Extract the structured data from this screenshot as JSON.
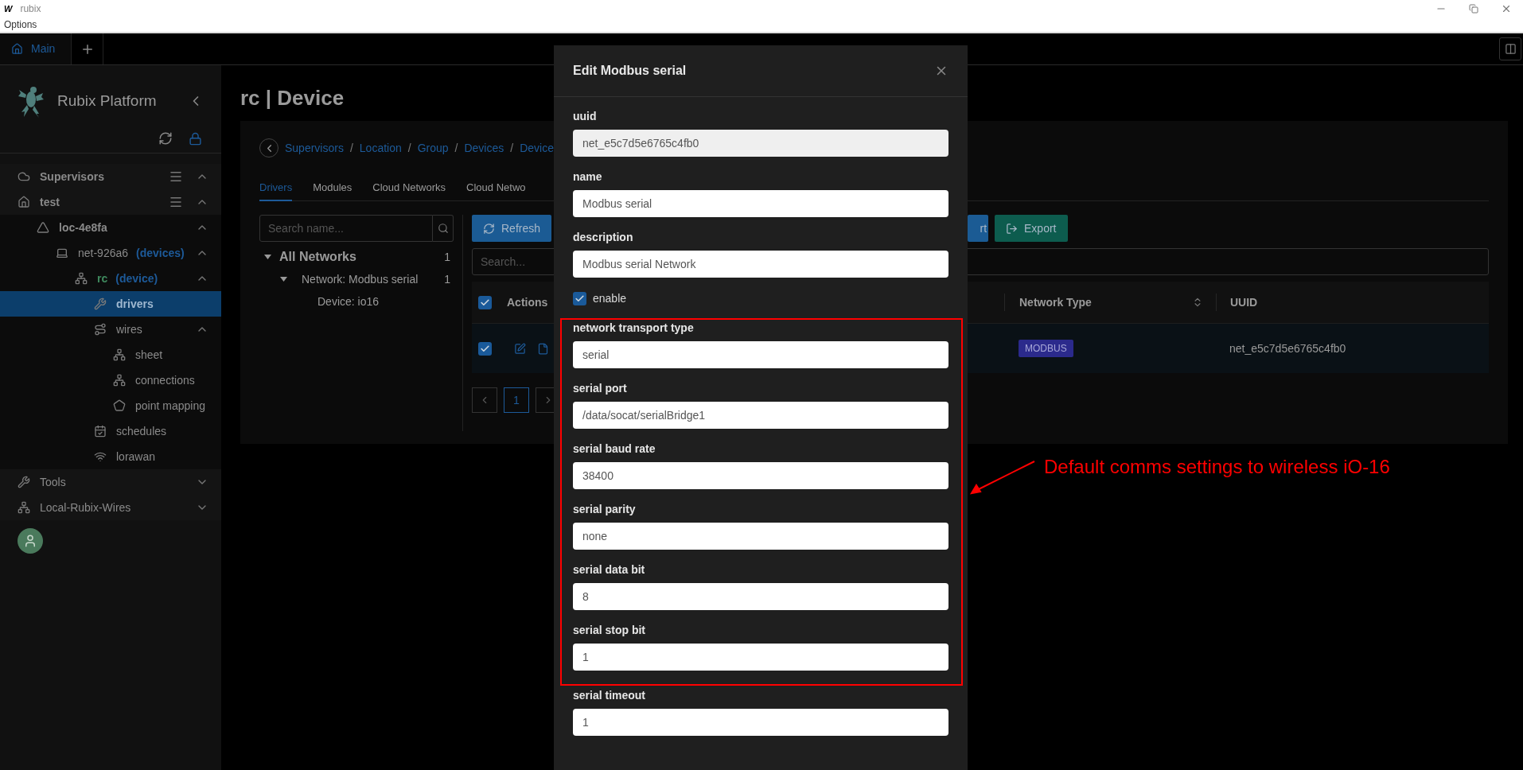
{
  "window": {
    "logo": "W",
    "title": "rubix",
    "menu": [
      "Options"
    ]
  },
  "tabs": [
    {
      "label": "Main",
      "selected": true
    }
  ],
  "sidebar": {
    "title": "Rubix Platform",
    "items": [
      {
        "label": "Supervisors",
        "kind": "cloud",
        "bold": true,
        "menu": true,
        "expanded": true,
        "selected": false
      },
      {
        "label": "test",
        "kind": "home",
        "bold": true,
        "menu": true,
        "expanded": true,
        "selected": false,
        "children": [
          {
            "label": "loc-4e8fa",
            "kind": "location",
            "bold": true,
            "menu": false,
            "expanded": true,
            "selected": false,
            "children": [
              {
                "label": "net-926a6",
                "tag": "(devices)",
                "kind": "laptop",
                "bold": false,
                "menu": false,
                "expanded": true,
                "selected": false,
                "children": [
                  {
                    "label": "rc",
                    "tag": "(device)",
                    "color": "#3f8a5e",
                    "kind": "hierarchy",
                    "bold": true,
                    "menu": false,
                    "expanded": true,
                    "selected": false,
                    "children": [
                      {
                        "label": "drivers",
                        "kind": "wrench",
                        "bold": true,
                        "menu": false,
                        "selected": true
                      },
                      {
                        "label": "wires",
                        "kind": "wires",
                        "bold": false,
                        "menu": false,
                        "expanded": true,
                        "selected": false,
                        "children": [
                          {
                            "label": "sheet",
                            "kind": "hierarchy",
                            "bold": false,
                            "menu": false,
                            "selected": false
                          },
                          {
                            "label": "connections",
                            "kind": "hierarchy",
                            "bold": false,
                            "menu": false,
                            "selected": false
                          },
                          {
                            "label": "point mapping",
                            "kind": "pentagon",
                            "bold": false,
                            "menu": false,
                            "selected": false
                          }
                        ]
                      },
                      {
                        "label": "schedules",
                        "kind": "calendar",
                        "bold": false,
                        "menu": false,
                        "selected": false
                      },
                      {
                        "label": "lorawan",
                        "kind": "wifi",
                        "bold": false,
                        "menu": false,
                        "selected": false
                      }
                    ]
                  }
                ]
              }
            ]
          }
        ]
      },
      {
        "label": "Tools",
        "kind": "wrench",
        "bold": false,
        "menu": false,
        "expanded": false,
        "selected": false
      },
      {
        "label": "Local-Rubix-Wires",
        "kind": "hierarchy",
        "bold": false,
        "menu": false,
        "expanded": false,
        "selected": false
      }
    ]
  },
  "page": {
    "title": "rc | Device",
    "breadcrumb": [
      "Supervisors",
      "Location",
      "Group",
      "Devices",
      "Device"
    ],
    "breadcrumb_separator": "/",
    "tabs": [
      {
        "label": "Drivers",
        "selected": true
      },
      {
        "label": "Modules",
        "selected": false
      },
      {
        "label": "Cloud Networks",
        "selected": false
      },
      {
        "label": "Cloud Netwo",
        "selected": false
      }
    ],
    "network_tree": {
      "placeholder": "Search name...",
      "items": [
        {
          "label": "All Networks",
          "count": "1",
          "expanded": true,
          "children": [
            {
              "label": "Network: Modbus serial",
              "count": "1",
              "expanded": true,
              "children": [
                {
                  "label": "Device: io16"
                }
              ]
            }
          ]
        }
      ]
    },
    "toolbar": [
      {
        "label": "Refresh",
        "kind": "refresh"
      },
      {
        "label": "rt",
        "kind": "import"
      },
      {
        "label": "Export",
        "kind": "export"
      }
    ],
    "table": {
      "placeholder": "Search...",
      "all_checked": true,
      "columns": [
        "Actions",
        "Network Type",
        "UUID"
      ],
      "rows": [
        {
          "checked": true,
          "network_type": "MODBUS",
          "uuid": "net_e5c7d5e6765c4fb0"
        }
      ]
    },
    "pagination": [
      {
        "label": "1",
        "selected": true
      }
    ]
  },
  "dialog": {
    "title": "Edit Modbus serial",
    "fields": [
      {
        "kind": "text",
        "label": "uuid",
        "value": "net_e5c7d5e6765c4fb0",
        "disabled": true
      },
      {
        "kind": "text",
        "label": "name",
        "value": "Modbus serial"
      },
      {
        "kind": "text",
        "label": "description",
        "value": "Modbus serial Network"
      },
      {
        "kind": "checkbox",
        "label": "enable",
        "checked": true
      }
    ],
    "highlighted_fields": [
      {
        "kind": "text",
        "label": "network transport type",
        "value": "serial"
      },
      {
        "kind": "text",
        "label": "serial port",
        "value": "/data/socat/serialBridge1"
      },
      {
        "kind": "text",
        "label": "serial baud rate",
        "value": "38400"
      },
      {
        "kind": "text",
        "label": "serial parity",
        "value": "none"
      },
      {
        "kind": "text",
        "label": "serial data bit",
        "value": "8"
      },
      {
        "kind": "text",
        "label": "serial stop bit",
        "value": "1"
      }
    ],
    "more_fields": [
      {
        "kind": "text",
        "label": "serial timeout",
        "value": "1"
      }
    ],
    "annotation": "Default comms settings to wireless iO-16"
  }
}
